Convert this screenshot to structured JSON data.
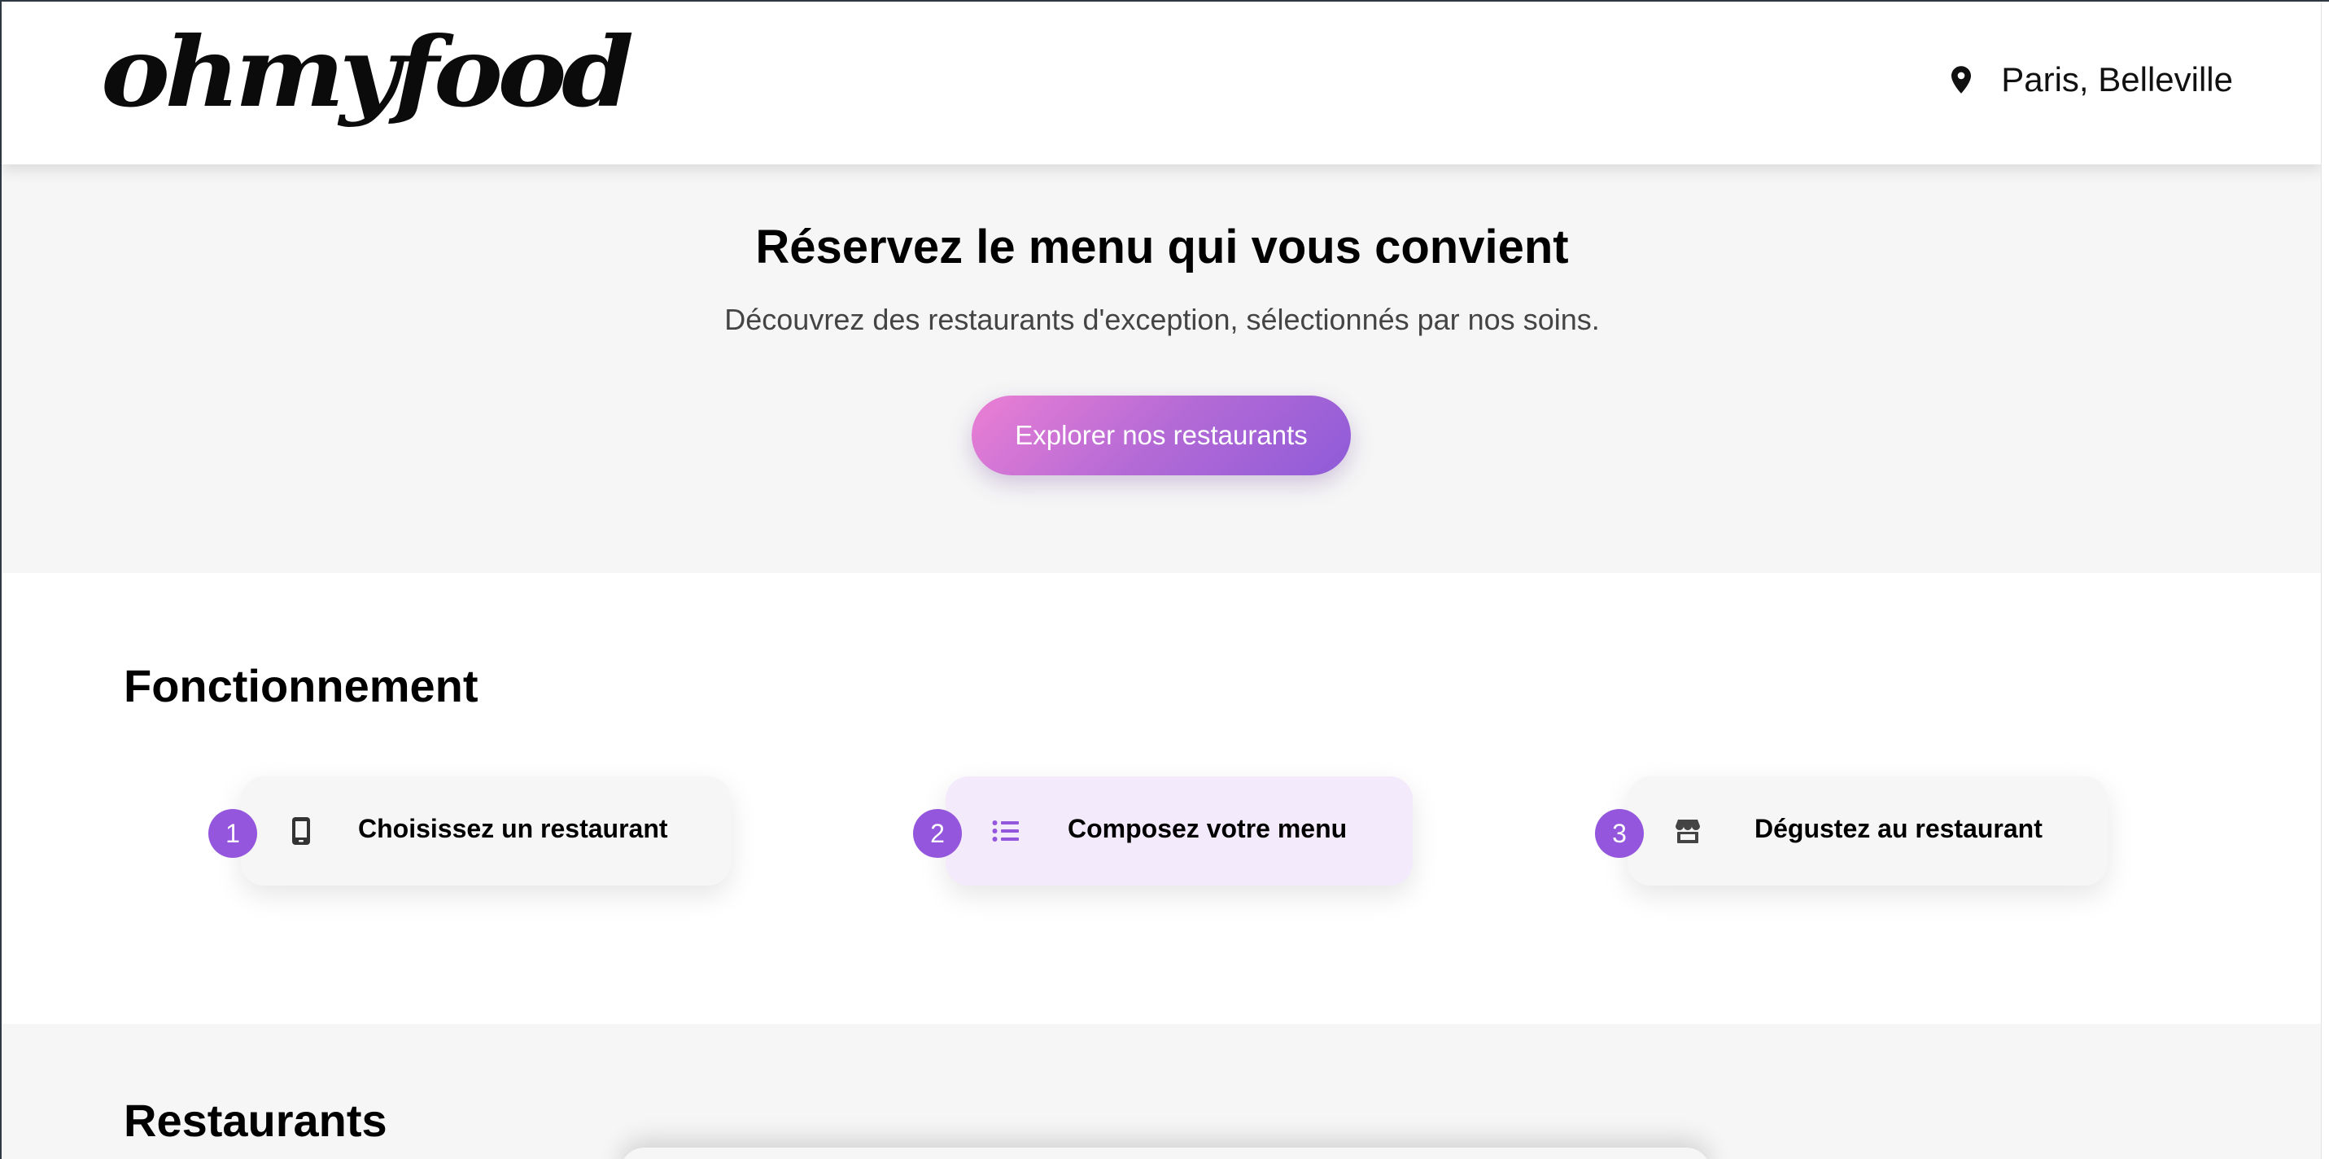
{
  "header": {
    "logo_text": "ohmyfood",
    "location": "Paris, Belleville",
    "location_icon": "map-pin-icon"
  },
  "hero": {
    "title": "Réservez le menu qui vous convient",
    "subtitle": "Découvrez des restaurants d'exception, sélectionnés par nos soins.",
    "cta_label": "Explorer nos restaurants"
  },
  "how_it_works": {
    "title": "Fonctionnement",
    "steps": [
      {
        "number": "1",
        "icon": "smartphone-icon",
        "label": "Choisissez un restaurant"
      },
      {
        "number": "2",
        "icon": "list-icon",
        "label": "Composez votre menu"
      },
      {
        "number": "3",
        "icon": "storefront-icon",
        "label": "Dégustez au restaurant"
      }
    ]
  },
  "restaurants": {
    "title": "Restaurants"
  },
  "colors": {
    "accent": "#9356dc",
    "gradient_start": "#eb7fd4",
    "gradient_end": "#8f5bd8",
    "section_bg": "#f6f6f6",
    "active_step_bg": "#f3eafb"
  }
}
